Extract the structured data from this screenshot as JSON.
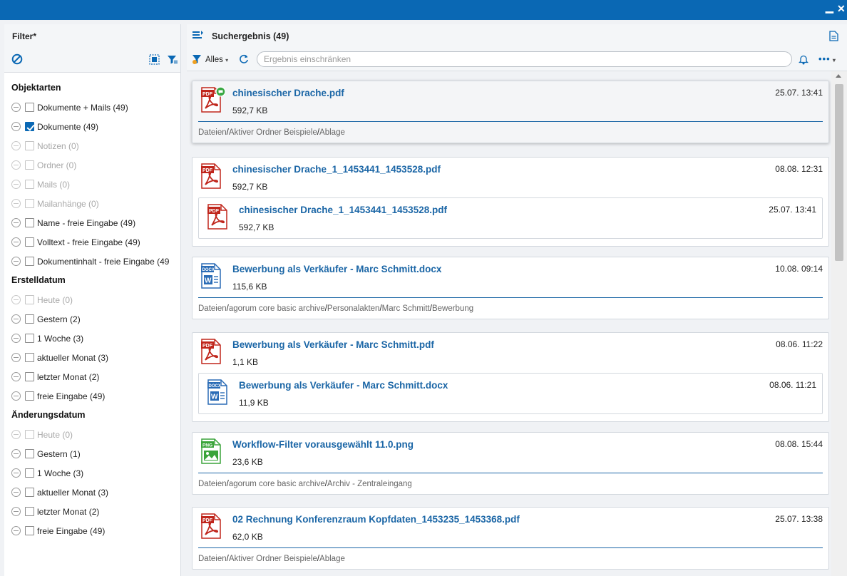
{
  "window": {
    "minimize": "▁",
    "close": "✕"
  },
  "filter": {
    "title": "Filter*",
    "groups": [
      {
        "title": "Objektarten",
        "items": [
          {
            "label": "Dokumente + Mails (49)",
            "checked": false,
            "disabled": false
          },
          {
            "label": "Dokumente (49)",
            "checked": true,
            "disabled": false
          },
          {
            "label": "Notizen (0)",
            "checked": false,
            "disabled": true
          },
          {
            "label": "Ordner (0)",
            "checked": false,
            "disabled": true
          },
          {
            "label": "Mails (0)",
            "checked": false,
            "disabled": true
          },
          {
            "label": "Mailanhänge (0)",
            "checked": false,
            "disabled": true
          },
          {
            "label": "Name - freie Eingabe (49)",
            "checked": false,
            "disabled": false
          },
          {
            "label": "Volltext - freie Eingabe (49)",
            "checked": false,
            "disabled": false
          },
          {
            "label": "Dokumentinhalt - freie Eingabe (49",
            "checked": false,
            "disabled": false
          }
        ]
      },
      {
        "title": "Erstelldatum",
        "items": [
          {
            "label": "Heute (0)",
            "checked": false,
            "disabled": true
          },
          {
            "label": "Gestern (2)",
            "checked": false,
            "disabled": false
          },
          {
            "label": "1 Woche (3)",
            "checked": false,
            "disabled": false
          },
          {
            "label": "aktueller Monat (3)",
            "checked": false,
            "disabled": false
          },
          {
            "label": "letzter Monat (2)",
            "checked": false,
            "disabled": false
          },
          {
            "label": "freie Eingabe (49)",
            "checked": false,
            "disabled": false
          }
        ]
      },
      {
        "title": "Änderungsdatum",
        "items": [
          {
            "label": "Heute (0)",
            "checked": false,
            "disabled": true
          },
          {
            "label": "Gestern (1)",
            "checked": false,
            "disabled": false
          },
          {
            "label": "1 Woche (3)",
            "checked": false,
            "disabled": false
          },
          {
            "label": "aktueller Monat (3)",
            "checked": false,
            "disabled": false
          },
          {
            "label": "letzter Monat (2)",
            "checked": false,
            "disabled": false
          },
          {
            "label": "freie Eingabe (49)",
            "checked": false,
            "disabled": false
          }
        ]
      }
    ]
  },
  "results": {
    "title": "Suchergebnis (49)",
    "scope": "Alles",
    "search_placeholder": "Ergebnis einschränken",
    "items": [
      {
        "name": "chinesischer Drache.pdf",
        "size": "592,7 KB",
        "date": "25.07. 13:41",
        "type": "pdf",
        "path": [
          "Dateien",
          "Aktiver Ordner Beispiele",
          "Ablage"
        ]
      },
      {
        "name": "chinesischer Drache_1_1453441_1453528.pdf",
        "size": "592,7 KB",
        "date": "08.08. 12:31",
        "type": "pdf",
        "child": {
          "name": "chinesischer Drache_1_1453441_1453528.pdf",
          "size": "592,7 KB",
          "date": "25.07. 13:41",
          "type": "pdf"
        }
      },
      {
        "name": "Bewerbung als Verkäufer - Marc Schmitt.docx",
        "size": "115,6 KB",
        "date": "10.08. 09:14",
        "type": "docx",
        "path": [
          "Dateien",
          "agorum core basic archive",
          "Personalakten",
          "Marc Schmitt",
          "Bewerbung"
        ]
      },
      {
        "name": "Bewerbung als Verkäufer - Marc Schmitt.pdf",
        "size": "1,1 KB",
        "date": "08.06. 11:22",
        "type": "pdf",
        "child": {
          "name": "Bewerbung als Verkäufer - Marc Schmitt.docx",
          "size": "11,9 KB",
          "date": "08.06. 11:21",
          "type": "docx"
        }
      },
      {
        "name": "Workflow-Filter vorausgewählt 11.0.png",
        "size": "23,6 KB",
        "date": "08.08. 15:44",
        "type": "png",
        "path": [
          "Dateien",
          "agorum core basic archive",
          "Archiv - Zentraleingang"
        ]
      },
      {
        "name": "02 Rechnung Konferenzraum Kopfdaten_1453235_1453368.pdf",
        "size": "62,0 KB",
        "date": "25.07. 13:38",
        "type": "pdf",
        "path": [
          "Dateien",
          "Aktiver Ordner Beispiele",
          "Ablage"
        ]
      }
    ]
  },
  "icons": {
    "minimize": "minimize-icon",
    "close": "close-icon",
    "clear_filter": "clear-filter-icon",
    "select_all": "select-all-icon",
    "filter_settings": "filter-settings-icon",
    "result_list": "result-list-icon",
    "export": "export-document-icon",
    "scope_filter": "scope-filter-icon",
    "refresh": "refresh-icon",
    "notifications": "bell-icon",
    "more": "more-options-icon"
  },
  "colors": {
    "titlebar": "#0a68b4",
    "link": "#1b66a6",
    "pdf": "#c0261c",
    "docx": "#2b6cb6",
    "png": "#3aa43a",
    "badge": "#3aa843"
  }
}
